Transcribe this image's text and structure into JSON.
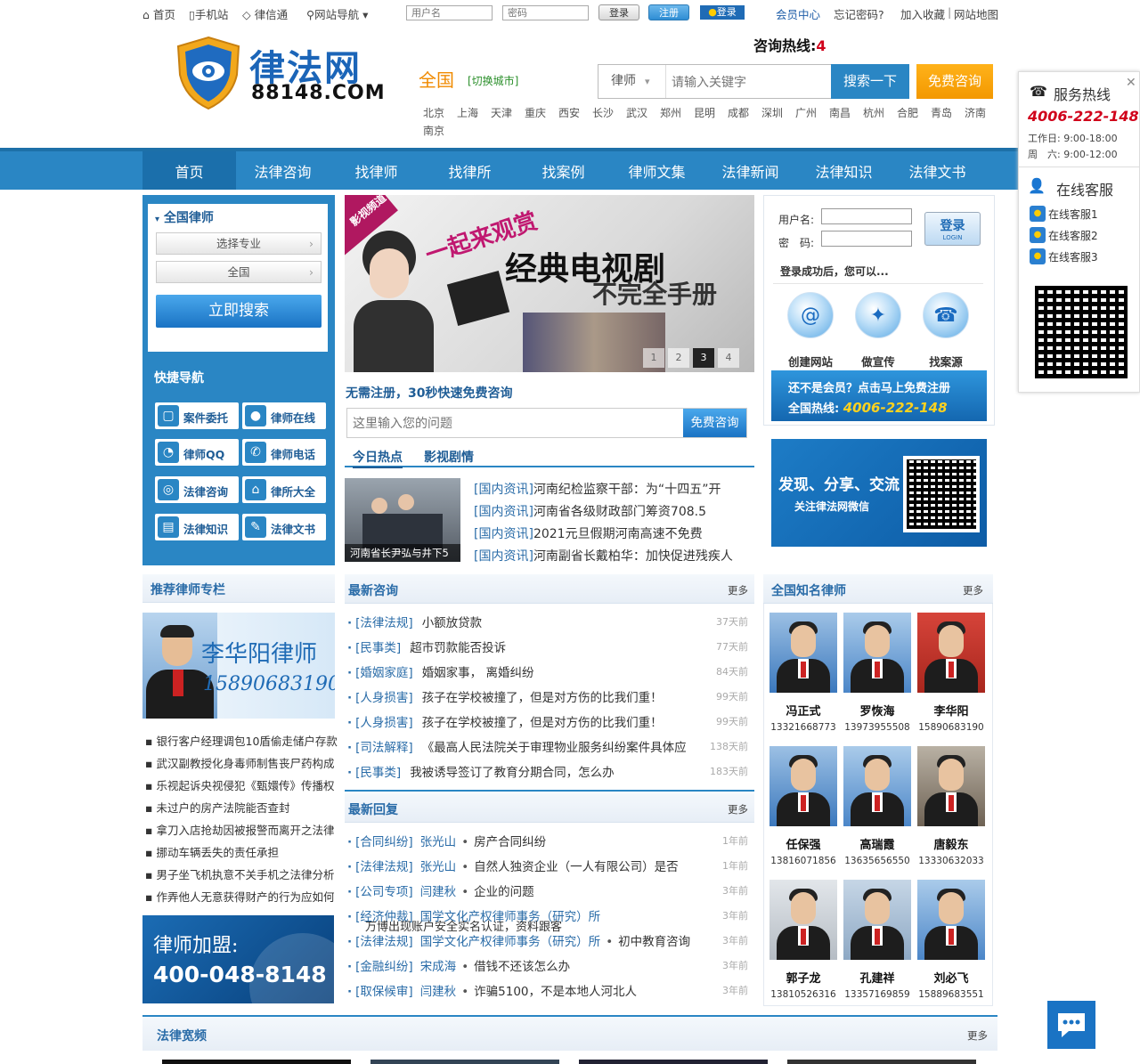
{
  "topbar": {
    "home": "首页",
    "mobile": "手机站",
    "lvxintong": "律信通",
    "site_nav": "网站导航",
    "username_placeholder": "用户名",
    "password_placeholder": "密码",
    "login": "登录",
    "register": "注册",
    "qq_login": "登录",
    "member_center": "会员中心",
    "forgot": "忘记密码?",
    "favorite": "加入收藏",
    "sitemap": "网站地图",
    "sep": "|"
  },
  "header": {
    "hotline_label": "咨询热线:",
    "hotline_value": "4",
    "logo_cn": "律法网",
    "logo_en": "88148.COM",
    "region": "全国",
    "switch_city": "[切换城市]",
    "search_type": "律师",
    "search_placeholder": "请输入关键字",
    "search_btn": "搜索一下",
    "free_consult": "免费咨询",
    "cities": [
      "北京",
      "上海",
      "天津",
      "重庆",
      "西安",
      "长沙",
      "武汉",
      "郑州",
      "昆明",
      "成都",
      "深圳",
      "广州",
      "南昌",
      "杭州",
      "合肥",
      "青岛",
      "济南"
    ],
    "city_wrap": "南京"
  },
  "nav": [
    "首页",
    "法律咨询",
    "找律师",
    "找律所",
    "找案例",
    "律师文集",
    "法律新闻",
    "法律知识",
    "法律文书"
  ],
  "left": {
    "title": "全国律师",
    "select_specialty": "选择专业",
    "select_region": "全国",
    "search_btn": "立即搜索",
    "quick_title": "快捷导航",
    "quick": [
      "案件委托",
      "律师在线",
      "律师QQ",
      "律师电话",
      "法律咨询",
      "律所大全",
      "法律知识",
      "法律文书"
    ]
  },
  "banner": {
    "tag": "影视频道",
    "line1": "一起来观赏",
    "line2": "经典电视剧",
    "line3": "不完全手册",
    "pages": [
      "1",
      "2",
      "3",
      "4"
    ]
  },
  "consult": {
    "title": "无需注册，30秒快速免费咨询",
    "placeholder": "这里输入您的问题",
    "btn": "免费咨询"
  },
  "hot": {
    "tab1": "今日热点",
    "tab2": "影视剧情",
    "thumb_caption": "河南省长尹弘与井下5",
    "items": [
      {
        "cat": "[国内资讯]",
        "text": "河南纪检监察干部：为“十四五”开"
      },
      {
        "cat": "[国内资讯]",
        "text": "河南省各级财政部门筹资708.5"
      },
      {
        "cat": "[国内资讯]",
        "text": "2021元旦假期河南高速不免费"
      },
      {
        "cat": "[国内资讯]",
        "text": "河南副省长戴柏华：加快促进残疾人"
      }
    ]
  },
  "login_box": {
    "user_label": "用户名:",
    "pwd_label": "密　码:",
    "login_btn": "登录",
    "login_btn_en": "LOGIN",
    "after": "登录成功后，您可以...",
    "features": [
      "创建网站",
      "做宣传",
      "找案源"
    ],
    "join_line1": "还不是会员？点击马上免费注册",
    "join_line2_label": "全国热线:",
    "join_line2_value": "4006-222-148"
  },
  "wechat": {
    "line1": "发现、分享、交流",
    "line2": "关注律法网微信"
  },
  "recommend": {
    "title": "推荐律师专栏",
    "lawyer_name": "李华阳律师",
    "lawyer_phone": "15890683190",
    "links": [
      "银行客户经理调包10盾偷走储户存款",
      "武汉副教授化身毒师制售丧尸药构成",
      "乐视起诉央视侵犯《甄嬛传》传播权",
      "未过户的房产法院能否查封",
      "拿刀入店抢劫因被报警而离开之法律",
      "挪动车辆丢失的责任承担",
      "男子坐飞机执意不关手机之法律分析",
      "作弄他人无意获得财产的行为应如何"
    ]
  },
  "join": {
    "title": "律师加盟:",
    "phone": "400-048-8148"
  },
  "latest_consult": {
    "title": "最新咨询",
    "more": "更多",
    "items": [
      {
        "cat": "[法律法规]",
        "text": "小额放贷款",
        "time": "37天前"
      },
      {
        "cat": "[民事类]",
        "text": "超市罚款能否投诉",
        "time": "77天前"
      },
      {
        "cat": "[婚姻家庭]",
        "text": "婚姻家事，  离婚纠纷",
        "time": "84天前"
      },
      {
        "cat": "[人身损害]",
        "text": "孩子在学校被撞了，但是对方伤的比我们重！",
        "time": "99天前"
      },
      {
        "cat": "[人身损害]",
        "text": "孩子在学校被撞了，但是对方伤的比我们重！",
        "time": "99天前"
      },
      {
        "cat": "[司法解释]",
        "text": "《最高人民法院关于审理物业服务纠纷案件具体应",
        "time": "138天前"
      },
      {
        "cat": "[民事类]",
        "text": "我被诱导签订了教育分期合同，怎么办",
        "time": "183天前"
      }
    ]
  },
  "latest_reply": {
    "title": "最新回复",
    "more": "更多",
    "items": [
      {
        "cat": "[合同纠纷]",
        "who": "张光山",
        "text": "房产合同纠纷",
        "time": "1年前"
      },
      {
        "cat": "[法律法规]",
        "who": "张光山",
        "text": "自然人独资企业（一人有限公司）是否",
        "time": "1年前"
      },
      {
        "cat": "[公司专项]",
        "who": "闫建秋",
        "text": "企业的问题",
        "time": "3年前"
      },
      {
        "cat": "[经济仲裁]",
        "who": "国学文化产权律师事务（研究）所",
        "text": "万博出现账户安全实名认证，资料跟客",
        "time": "3年前"
      },
      {
        "cat": "[法律法规]",
        "who": "国学文化产权律师事务（研究）所",
        "text": "初中教育咨询",
        "time": "3年前"
      },
      {
        "cat": "[金融纠纷]",
        "who": "宋成海",
        "text": "借钱不还该怎么办",
        "time": "3年前"
      },
      {
        "cat": "[取保候审]",
        "who": "闫建秋",
        "text": "诈骗5100，不是本地人河北人",
        "time": "3年前"
      }
    ]
  },
  "famous": {
    "title": "全国知名律师",
    "more": "更多",
    "lawyers": [
      {
        "name": "冯正式",
        "tel": "13321668773"
      },
      {
        "name": "罗恢海",
        "tel": "13973955508"
      },
      {
        "name": "李华阳",
        "tel": "15890683190"
      },
      {
        "name": "任保强",
        "tel": "13816071856"
      },
      {
        "name": "高瑞霞",
        "tel": "13635656550"
      },
      {
        "name": "唐毅东",
        "tel": "13330632033"
      },
      {
        "name": "郭子龙",
        "tel": "13810526316"
      },
      {
        "name": "孔建祥",
        "tel": "13357169859"
      },
      {
        "name": "刘必飞",
        "tel": "15889683551"
      }
    ]
  },
  "video": {
    "title": "法律宽频",
    "more": "更多"
  },
  "service": {
    "title": "服务热线",
    "phone": "4006-222-148",
    "hours1": "工作日: 9:00-18:00",
    "hours2": "周　六: 9:00-12:00",
    "online_title": "在线客服",
    "online": [
      "在线客服1",
      "在线客服2",
      "在线客服3"
    ]
  },
  "colors": {
    "brand": "#2a86c4",
    "accent": "#f39800",
    "phone_red": "#d0021b"
  }
}
